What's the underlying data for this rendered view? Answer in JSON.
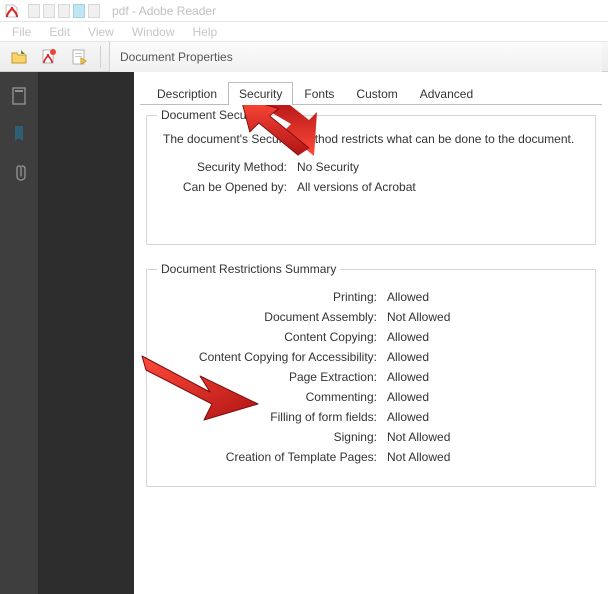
{
  "titlebar": {
    "title": "pdf - Adobe Reader"
  },
  "menu": {
    "items": [
      "File",
      "Edit",
      "View",
      "Window",
      "Help"
    ]
  },
  "dialog": {
    "title": "Document Properties",
    "tabs": [
      "Description",
      "Security",
      "Fonts",
      "Custom",
      "Advanced"
    ],
    "activeTab": "Security",
    "security": {
      "groupTitle": "Document Security",
      "lead": "The document's Security Method restricts what can be done to the document.",
      "rows": [
        {
          "label": "Security Method:",
          "value": "No Security"
        },
        {
          "label": "Can be Opened by:",
          "value": "All versions of Acrobat"
        }
      ]
    },
    "restrictions": {
      "groupTitle": "Document Restrictions Summary",
      "rows": [
        {
          "label": "Printing:",
          "value": "Allowed"
        },
        {
          "label": "Document Assembly:",
          "value": "Not Allowed"
        },
        {
          "label": "Content Copying:",
          "value": "Allowed"
        },
        {
          "label": "Content Copying for Accessibility:",
          "value": "Allowed"
        },
        {
          "label": "Page Extraction:",
          "value": "Allowed"
        },
        {
          "label": "Commenting:",
          "value": "Allowed"
        },
        {
          "label": "Filling of form fields:",
          "value": "Allowed"
        },
        {
          "label": "Signing:",
          "value": "Not Allowed"
        },
        {
          "label": "Creation of Template Pages:",
          "value": "Not Allowed"
        }
      ]
    }
  }
}
